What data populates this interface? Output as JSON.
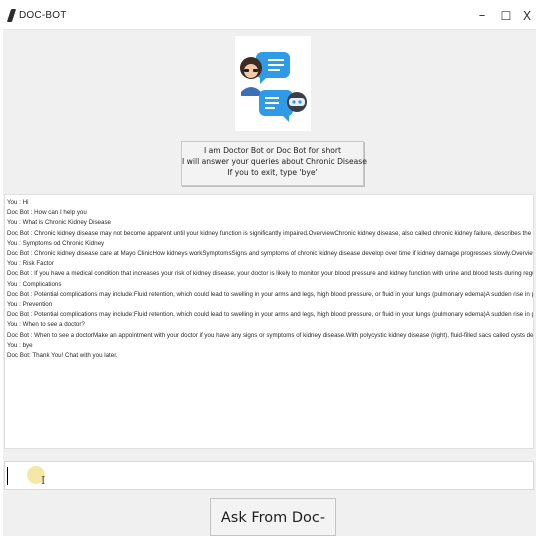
{
  "window": {
    "title": "DOC-BOT",
    "minimize_glyph": "–",
    "maximize_glyph": "☐",
    "close_glyph": "X"
  },
  "logo": {
    "icon": "doctor-and-robot-chat-bubbles-icon",
    "doctor_bubble_color": "#2f9be6",
    "robot_bubble_color": "#2f9be6"
  },
  "intro": {
    "line1": "I am Doctor Bot or Doc Bot for short",
    "line2": "I will answer your queries about Chronic Disease",
    "line3": "If you to exit, type 'bye'"
  },
  "chat": {
    "lines": [
      "You : Hi",
      "Doc Bot : How can I help you",
      "You : What is Chronic Kidney Disease",
      "Doc Bot : Chronic kidney disease may not become apparent until your kidney function is significantly impaired.OverviewChronic kidney disease, also called chronic kidney failure, describes the gradual     loss of kidney",
      "You : Symptoms od Chronic Kidney",
      "Doc Bot : Chronic kidney disease care at Mayo ClinicHow kidneys workSymptomsSigns and symptoms of chronic kidney disease develop over time if kidney damage progresses slowly.OverviewChronic kid",
      "You : Risk Factor",
      "Doc Bot : If you have a medical condition that increases your risk of kidney disease, your doctor is likely to monitor your blood pressure and kidney function with urine and blood tests during regular office visits.Potenti",
      "You : Complications",
      "Doc Bot : Potential complications may include:Fluid retention, which could lead to swelling in your arms and legs, high blood pressure, or fluid in your lungs (pulmonary edema)A sudden rise in pota          ssium levels",
      "You : Prevention",
      "Doc Bot : Potential complications may include:Fluid retention, which could lead to swelling in your arms and legs, high blood pressure, or fluid in your lungs (pulmonary edema)A sudden rise in pota          ssium levels",
      "You : When to see a doctor?",
      "Doc Bot : When to see a doctorMake an appointment with your doctor if you have any signs or symptoms of kidney disease.With polycystic kidney disease (right), fluid-filled sacs called cysts develop i     n the kidneys,",
      "You : bye",
      "Doc Bot: Thank You! Chat with you later."
    ]
  },
  "input": {
    "value": "",
    "cursor_icon": "text-cursor-icon",
    "ibeam_glyph": "I"
  },
  "ask_button": {
    "label": "Ask From Doc-Bot"
  }
}
